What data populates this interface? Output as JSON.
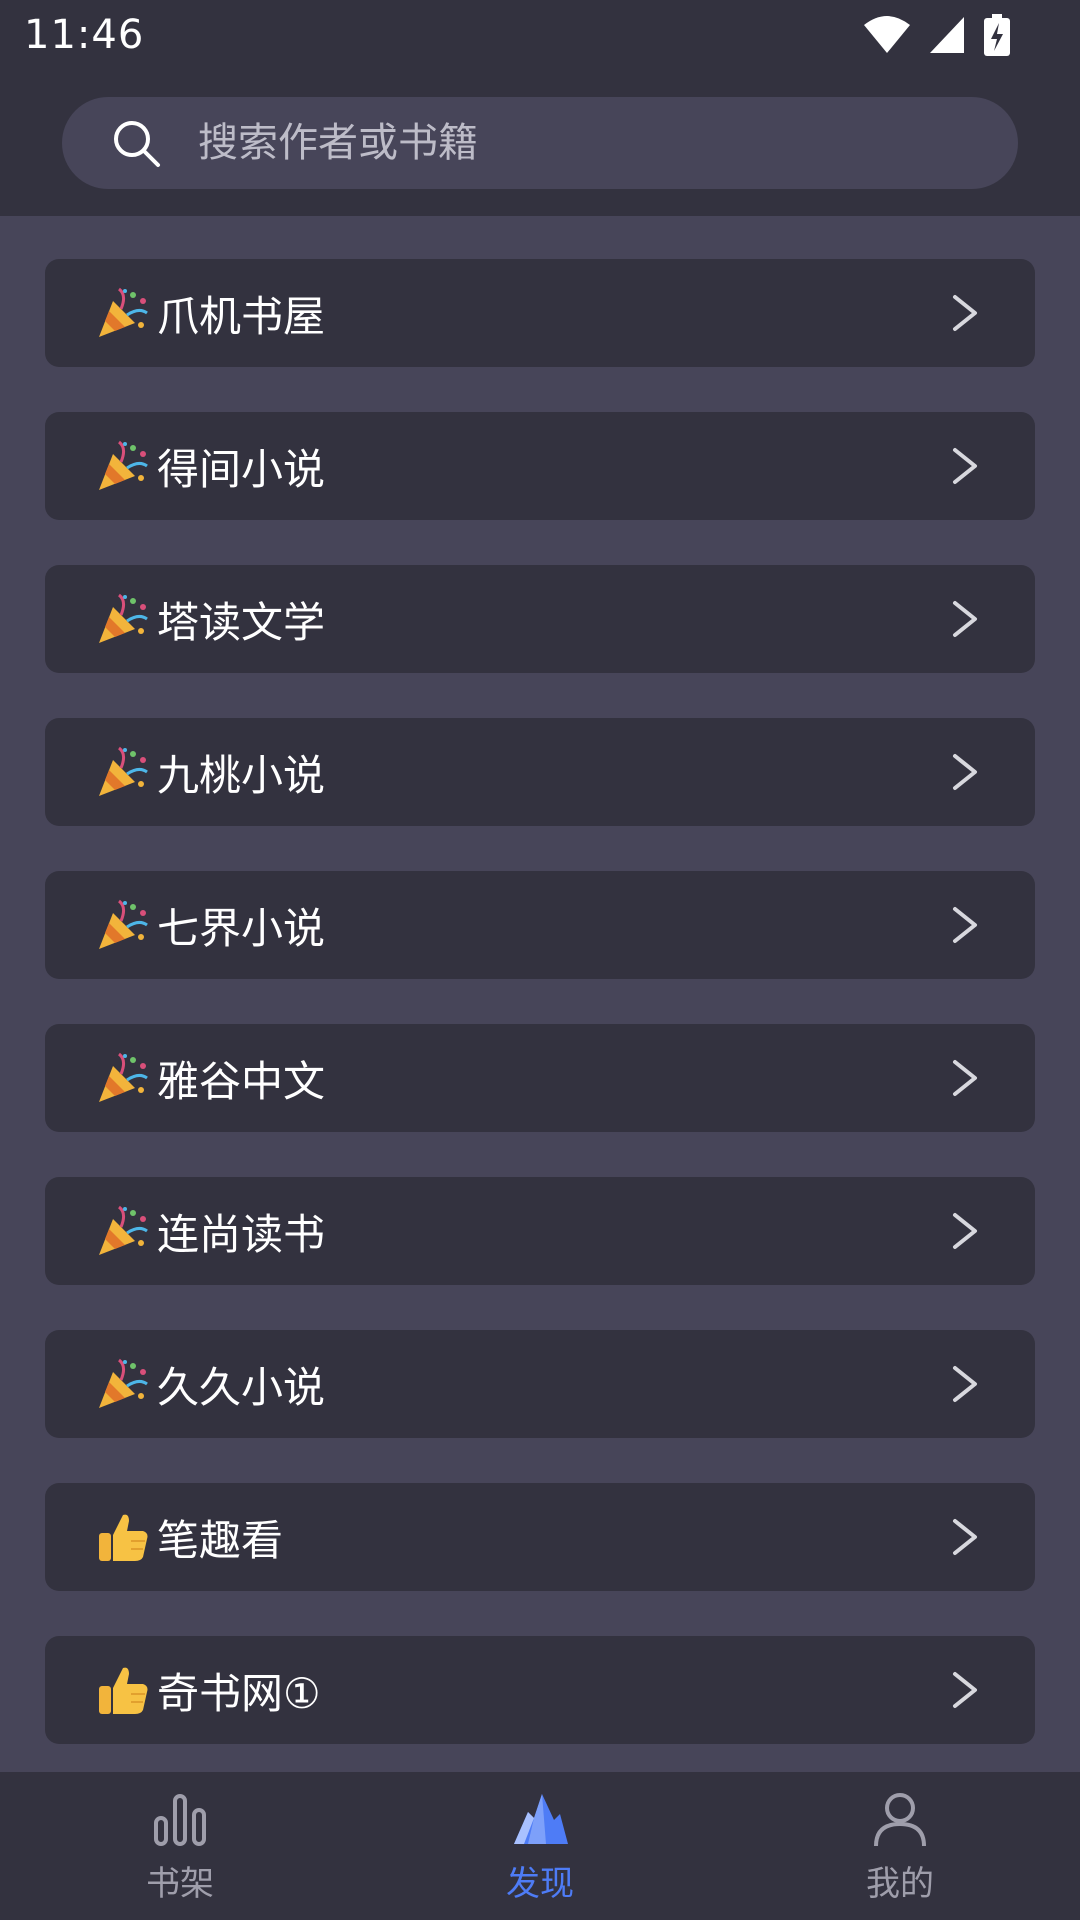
{
  "status_bar": {
    "time": "11:46"
  },
  "search": {
    "placeholder": "搜索作者或书籍"
  },
  "sources": [
    {
      "label": "爪机书屋",
      "icon": "party-popper-icon"
    },
    {
      "label": "得间小说",
      "icon": "party-popper-icon"
    },
    {
      "label": "塔读文学",
      "icon": "party-popper-icon"
    },
    {
      "label": "九桃小说",
      "icon": "party-popper-icon"
    },
    {
      "label": "七界小说",
      "icon": "party-popper-icon"
    },
    {
      "label": "雅谷中文",
      "icon": "party-popper-icon"
    },
    {
      "label": "连尚读书",
      "icon": "party-popper-icon"
    },
    {
      "label": "久久小说",
      "icon": "party-popper-icon"
    },
    {
      "label": "笔趣看",
      "icon": "thumbs-up-icon"
    },
    {
      "label": "奇书网①",
      "icon": "thumbs-up-icon"
    }
  ],
  "bottom_nav": {
    "items": [
      {
        "label": "书架",
        "icon": "bar-chart-icon"
      },
      {
        "label": "发现",
        "icon": "iceberg-icon"
      },
      {
        "label": "我的",
        "icon": "person-icon"
      }
    ],
    "active": "发现",
    "active_color": "#4e7cf6"
  },
  "colors": {
    "background": "#474559",
    "bar": "#33323f",
    "text": "#ffffff",
    "inactive_nav": "#9f9eab"
  }
}
